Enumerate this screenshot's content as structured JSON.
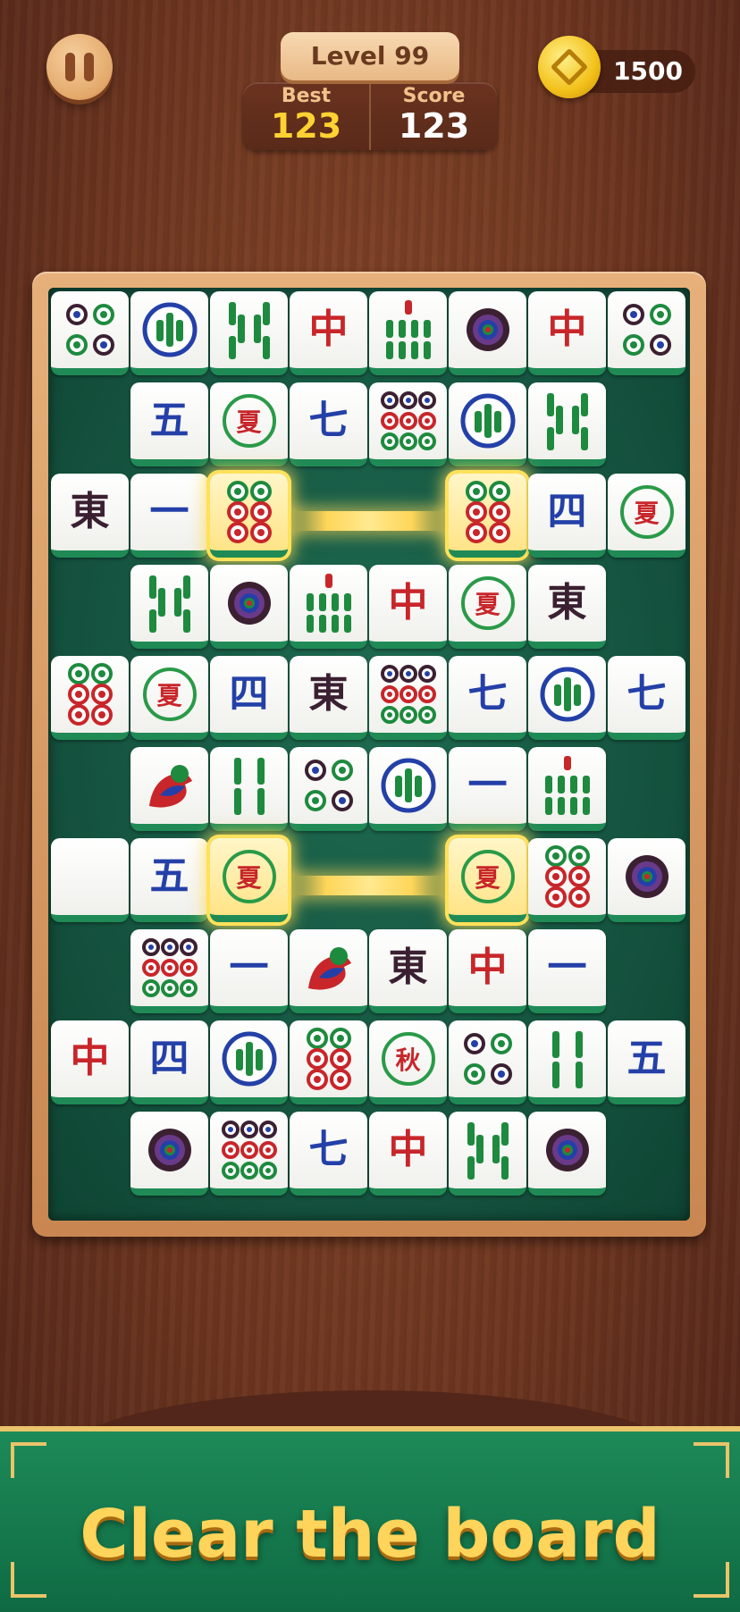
{
  "hud": {
    "level_label": "Level 99",
    "best_label": "Best",
    "best_value": "123",
    "score_label": "Score",
    "score_value": "123",
    "coins": "1500"
  },
  "board": {
    "rows": [
      [
        "dots4",
        "bamboo1",
        "bamboo8",
        "中",
        "bamboo6",
        "dots1",
        "中",
        "dots4"
      ],
      [
        null,
        "五",
        "夏",
        "七",
        "dots9",
        "bamboo1",
        "bamboo8",
        null
      ],
      [
        "東",
        "一",
        "dots6*",
        "",
        "",
        "dots6*",
        "四",
        "夏"
      ],
      [
        null,
        "bamboo8",
        "dots1",
        "bamboo6",
        "中",
        "夏",
        "東",
        null
      ],
      [
        "dots6",
        "夏",
        "四",
        "東",
        "dots9",
        "七",
        "bamboo1",
        "七"
      ],
      [
        null,
        "bird",
        "bamboo4",
        "dots4",
        "bamboo1",
        "一",
        "bamboo6",
        null
      ],
      [
        "blank",
        "五",
        "夏*",
        "",
        "",
        "夏*",
        "dots6",
        "dots1"
      ],
      [
        null,
        "dots9",
        "一",
        "bird",
        "東",
        "中",
        "一",
        null
      ],
      [
        "中",
        "四",
        "bamboo1",
        "dots6",
        "秋",
        "dots4",
        "bamboo4",
        "五"
      ],
      [
        null,
        "dots1",
        "dots9",
        "七",
        "中",
        "bamboo8",
        "dots1",
        null
      ]
    ]
  },
  "banner": {
    "headline": "Clear the board"
  }
}
